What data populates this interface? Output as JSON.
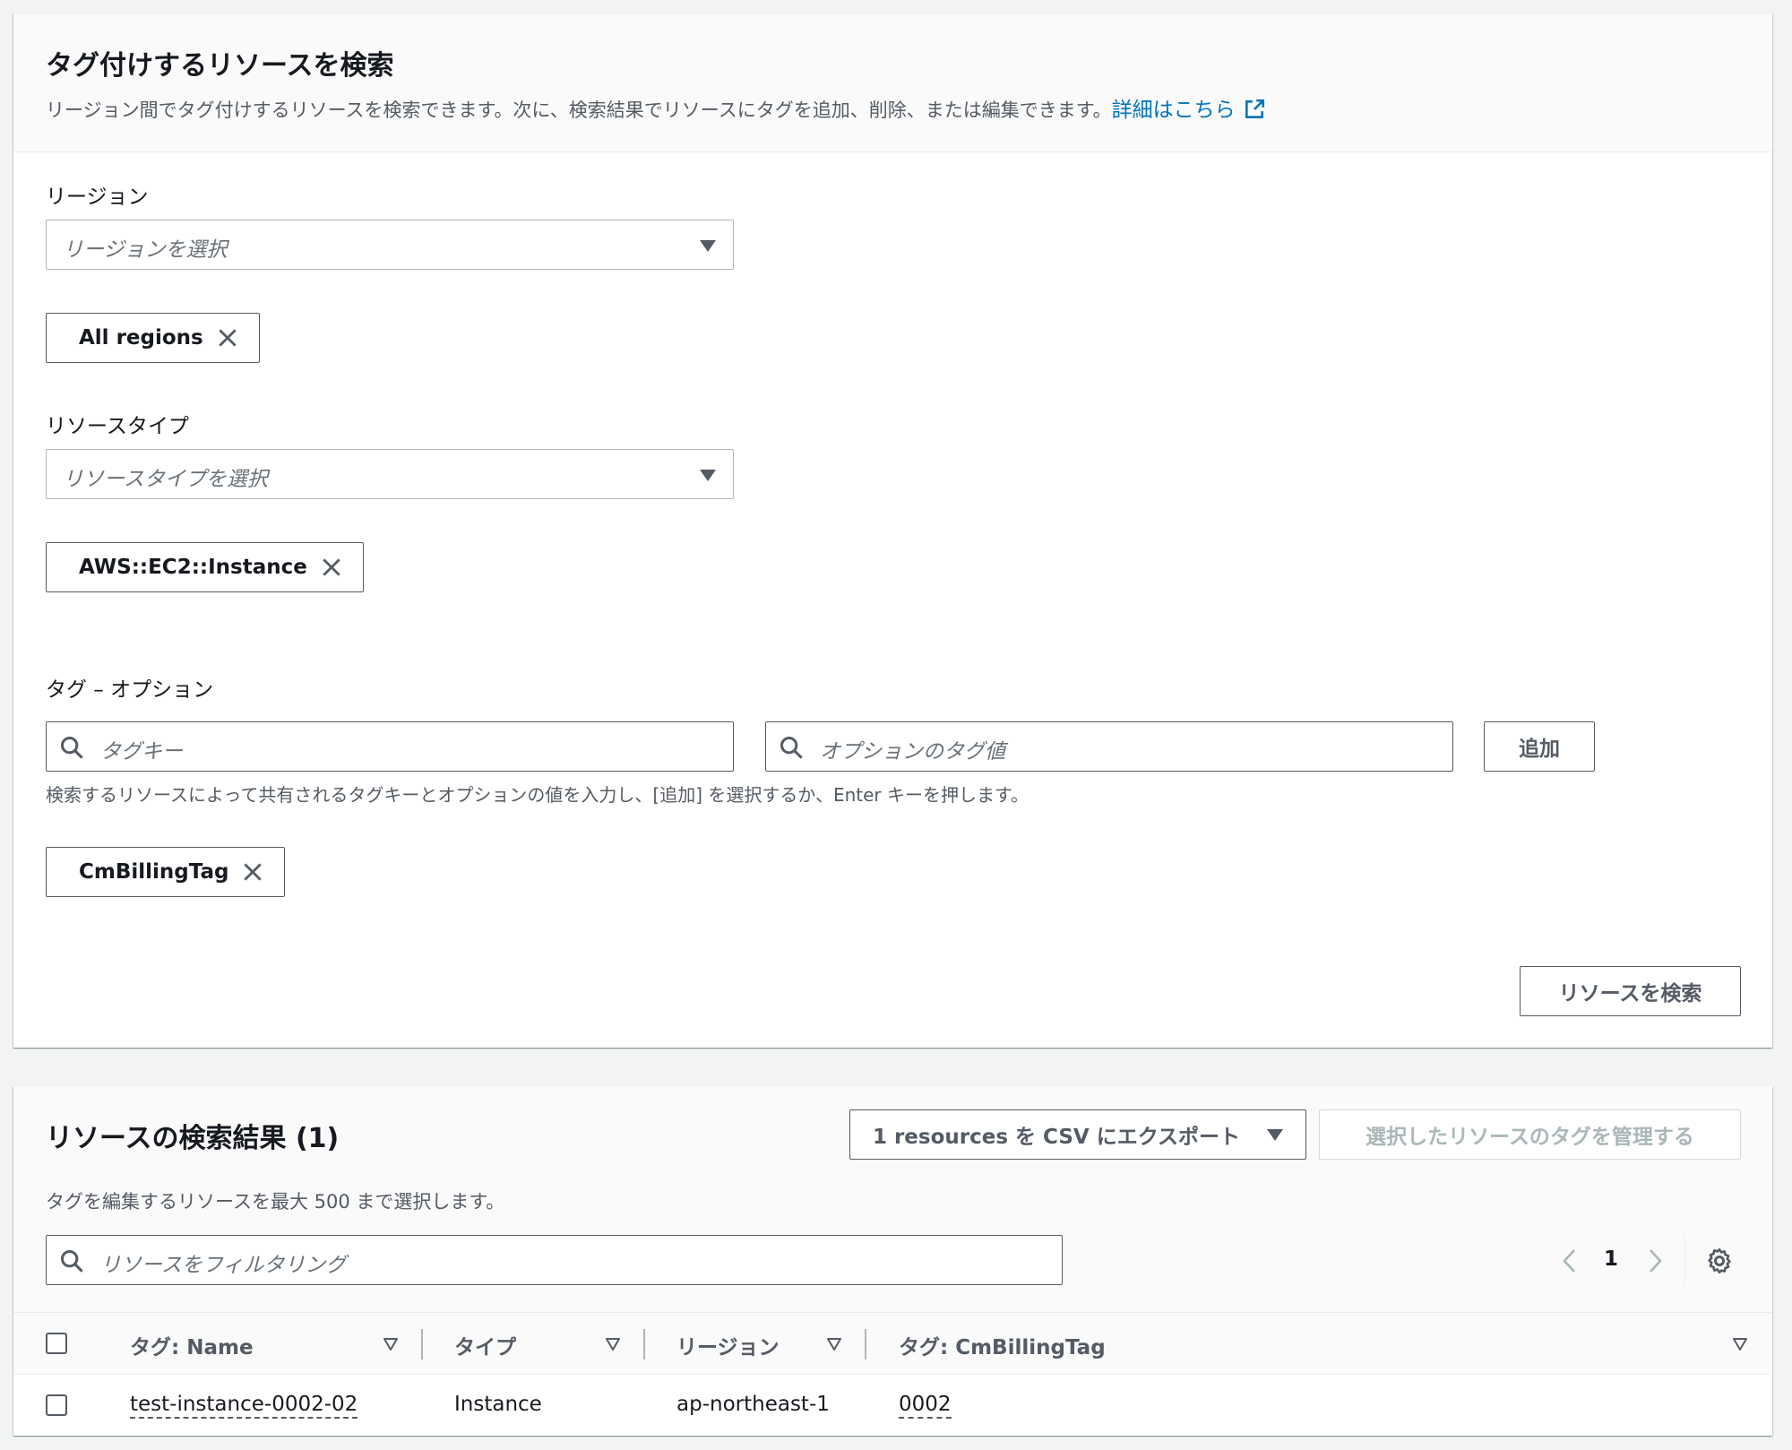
{
  "search_panel": {
    "title": "タグ付けするリソースを検索",
    "description": "リージョン間でタグ付けするリソースを検索できます。次に、検索結果でリソースにタグを追加、削除、または編集できます。",
    "learn_more_link": "詳細はこちら",
    "region": {
      "label": "リージョン",
      "placeholder": "リージョンを選択",
      "selected_token": "All regions"
    },
    "resource_type": {
      "label": "リソースタイプ",
      "placeholder": "リソースタイプを選択",
      "selected_token": "AWS::EC2::Instance"
    },
    "tags": {
      "label": "タグ – オプション",
      "key_placeholder": "タグキー",
      "value_placeholder": "オプションのタグ値",
      "add_button": "追加",
      "hint": "検索するリソースによって共有されるタグキーとオプションの値を入力し、[追加] を選択するか、Enter キーを押します。",
      "selected_token": "CmBillingTag"
    },
    "search_button": "リソースを検索"
  },
  "results_panel": {
    "title": "リソースの検索結果",
    "count": "(1)",
    "export_button": "1 resources を CSV にエクスポート",
    "manage_tags_button": "選択したリソースのタグを管理する",
    "description": "タグを編集するリソースを最大 500 まで選択します。",
    "filter_placeholder": "リソースをフィルタリング",
    "pagination": {
      "current_page": "1"
    },
    "columns": [
      "タグ: Name",
      "タイプ",
      "リージョン",
      "タグ: CmBillingTag"
    ],
    "rows": [
      {
        "name": "test-instance-0002-02",
        "type": "Instance",
        "region": "ap-northeast-1",
        "cm_billing_tag": "0002"
      }
    ]
  },
  "colors": {
    "link": "#0073bb",
    "text": "#16191f",
    "secondary_text": "#545b64",
    "placeholder": "#687078",
    "border": "#545b64",
    "disabled": "#aab7b8",
    "header_bg": "#fafafa",
    "page_bg": "#f2f3f3"
  },
  "icons": [
    "external-link-icon",
    "chevron-down-icon",
    "close-icon",
    "search-icon",
    "chevron-left-icon",
    "chevron-right-icon",
    "gear-icon",
    "sort-icon"
  ]
}
